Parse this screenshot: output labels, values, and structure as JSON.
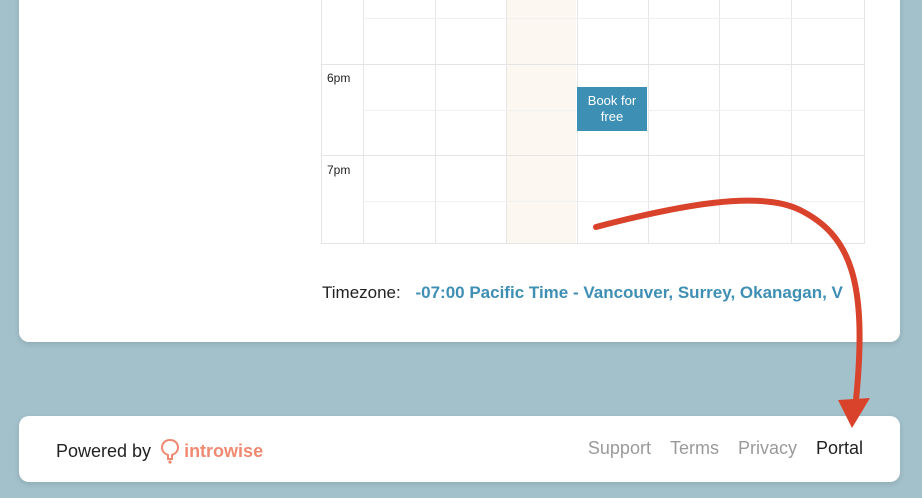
{
  "calendar": {
    "time_labels": [
      "6pm",
      "7pm"
    ],
    "book_button": "Book for free"
  },
  "timezone": {
    "label": "Timezone:",
    "value": "-07:00 Pacific Time - Vancouver, Surrey, Okanagan, V"
  },
  "footer": {
    "powered_by": "Powered by",
    "brand": "introwise",
    "links": [
      "Support",
      "Terms",
      "Privacy",
      "Portal"
    ]
  },
  "colors": {
    "background": "#a3c1cb",
    "accent": "#3d8fb3",
    "brand": "#ef8a72",
    "arrow": "#d9432b"
  },
  "icons": {
    "brand_logo": "introwise-logo-icon",
    "arrow": "red-curved-arrow"
  }
}
